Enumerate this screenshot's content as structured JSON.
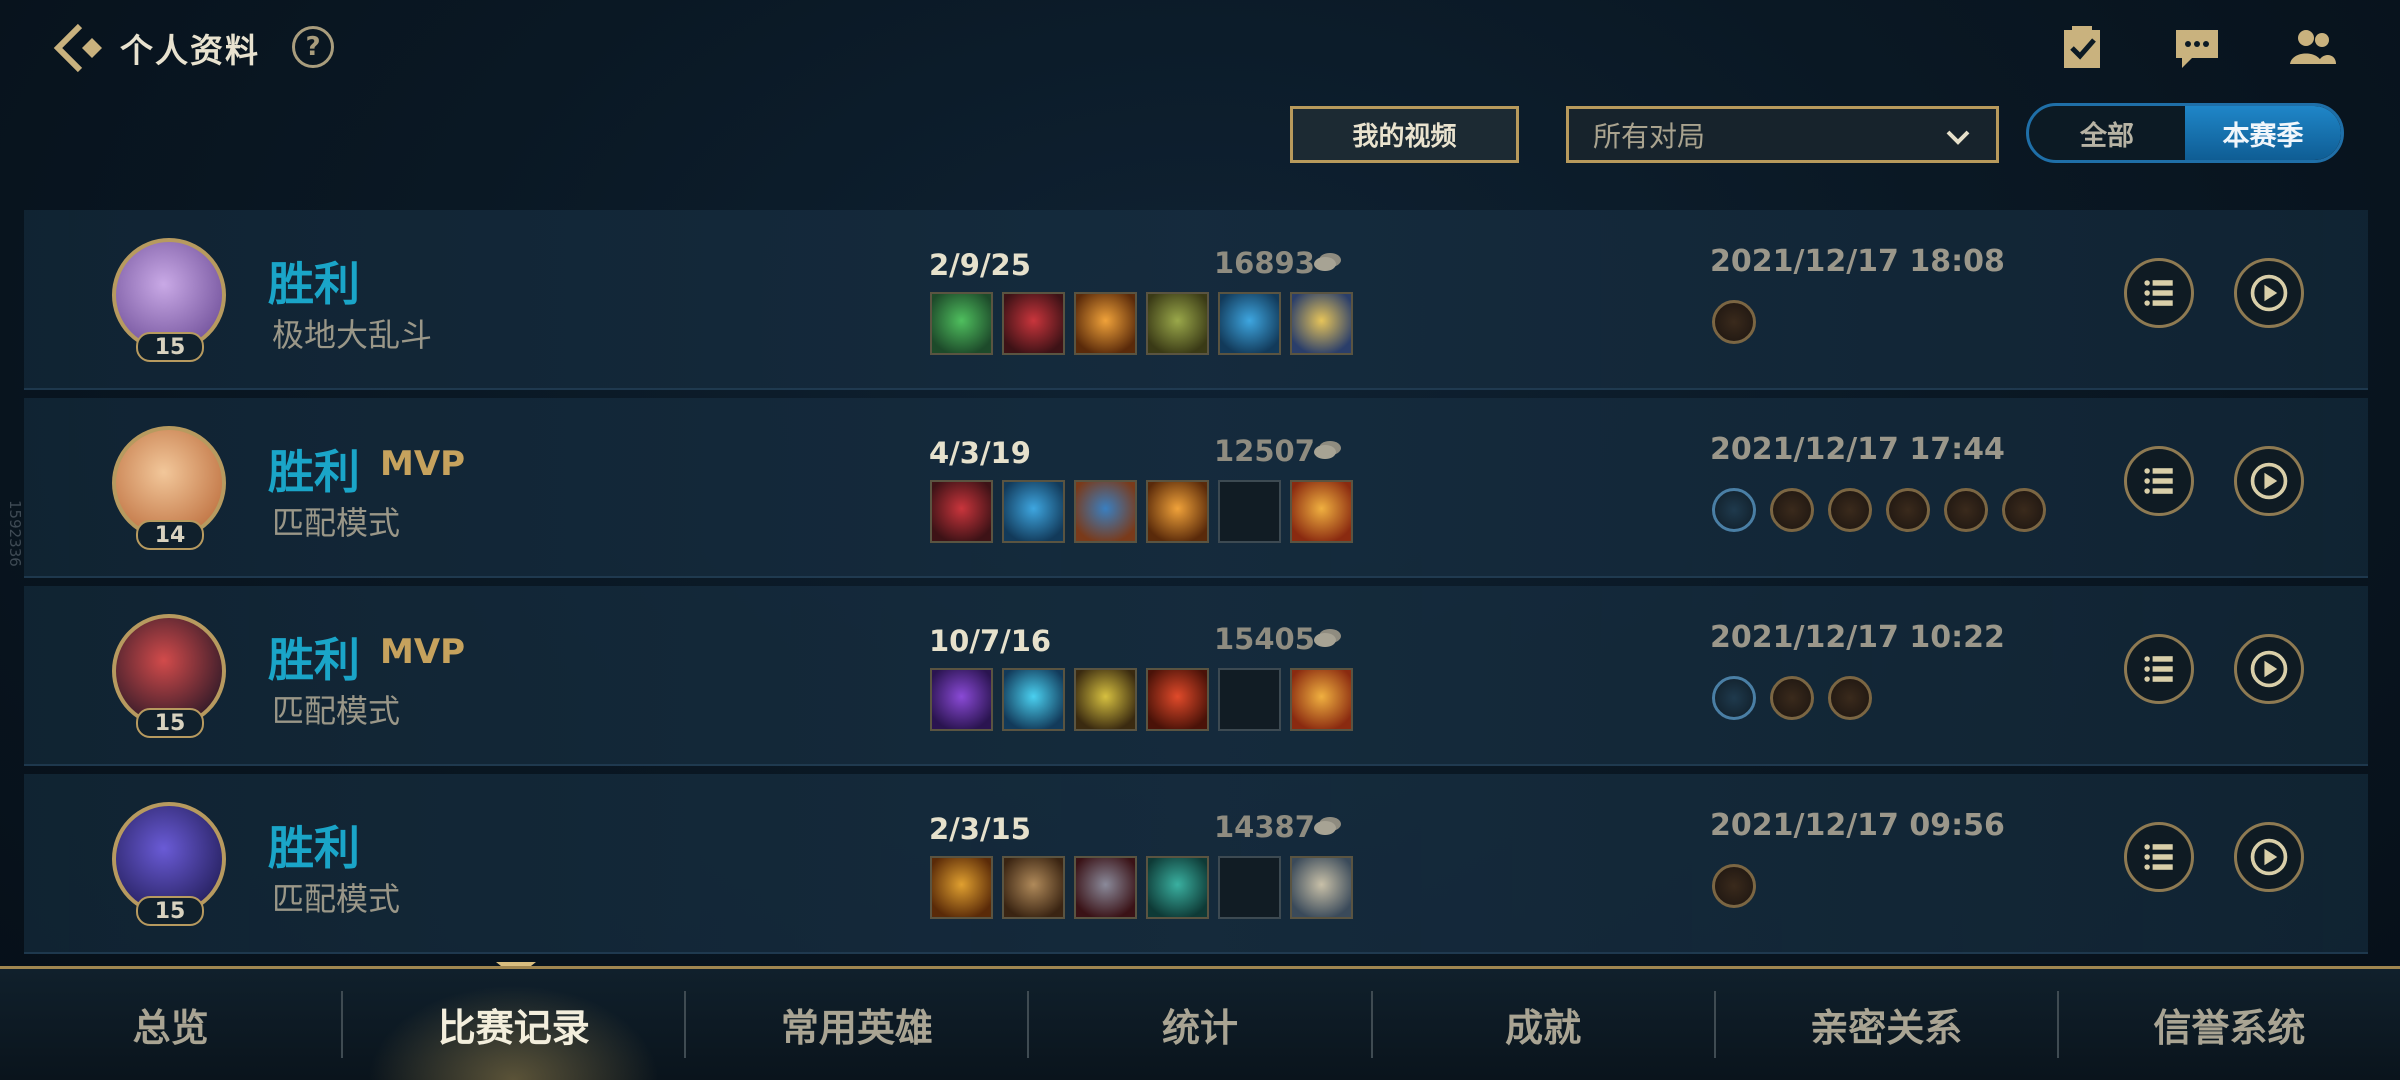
{
  "header": {
    "title": "个人资料",
    "help_label": "?",
    "icons": [
      "checklist-icon",
      "chat-icon",
      "friends-icon"
    ]
  },
  "filters": {
    "video_button": "我的视频",
    "queue_select_value": "所有对局",
    "season_toggle": [
      "全部",
      "本赛季"
    ],
    "season_selected": "本赛季"
  },
  "side_text": "1592336",
  "matches": [
    {
      "level": "15",
      "result": "胜利",
      "mvp": "",
      "mode": "极地大乱斗",
      "kda": "2/9/25",
      "gold": "16893",
      "time": "2021/12/17 18:08",
      "items": [
        "item-green",
        "item-red",
        "item-orange",
        "item-green2",
        "item-blue",
        "item-gold"
      ],
      "badges": 1,
      "avatar_colors": [
        "#c9a9e6",
        "#7a5aa2"
      ]
    },
    {
      "level": "14",
      "result": "胜利",
      "mvp": "MVP",
      "mode": "匹配模式",
      "kda": "4/3/19",
      "gold": "12507",
      "time": "2021/12/17 17:44",
      "items": [
        "item-red",
        "item-blue",
        "item-book",
        "item-orange",
        "empty",
        "item-fire"
      ],
      "badges": 6,
      "avatar_colors": [
        "#f2c79a",
        "#c47a4a"
      ]
    },
    {
      "level": "15",
      "result": "胜利",
      "mvp": "MVP",
      "mode": "匹配模式",
      "kda": "10/7/16",
      "gold": "15405",
      "time": "2021/12/17 10:22",
      "items": [
        "item-purple",
        "item-cyan",
        "item-yellow",
        "item-red2",
        "empty",
        "item-fire"
      ],
      "badges": 3,
      "avatar_colors": [
        "#d24b4b",
        "#3a1d2a"
      ]
    },
    {
      "level": "15",
      "result": "胜利",
      "mvp": "",
      "mode": "匹配模式",
      "kda": "2/3/15",
      "gold": "14387",
      "time": "2021/12/17 09:56",
      "items": [
        "item-gold2",
        "item-brown",
        "item-dark",
        "item-teal",
        "empty",
        "item-silver"
      ],
      "badges": 1,
      "avatar_colors": [
        "#6a5bd6",
        "#2a2466"
      ]
    }
  ],
  "nav": {
    "tabs": [
      "总览",
      "比赛记录",
      "常用英雄",
      "统计",
      "成就",
      "亲密关系",
      "信誉系统"
    ],
    "active": "比赛记录"
  }
}
